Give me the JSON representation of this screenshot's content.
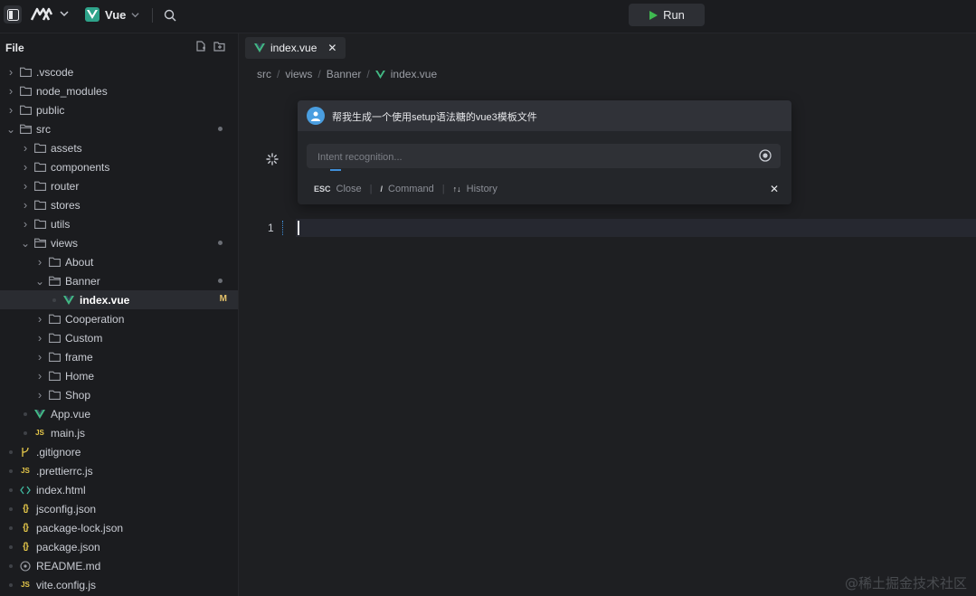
{
  "topbar": {
    "framework": "Vue",
    "run_label": "Run"
  },
  "sidebar": {
    "title": "File",
    "tree": [
      {
        "label": ".vscode",
        "type": "folder",
        "depth": 0,
        "open": false
      },
      {
        "label": "node_modules",
        "type": "folder",
        "depth": 0,
        "open": false
      },
      {
        "label": "public",
        "type": "folder",
        "depth": 0,
        "open": false
      },
      {
        "label": "src",
        "type": "folder",
        "depth": 0,
        "open": true,
        "badge": "dot"
      },
      {
        "label": "assets",
        "type": "folder",
        "depth": 1,
        "open": false
      },
      {
        "label": "components",
        "type": "folder",
        "depth": 1,
        "open": false
      },
      {
        "label": "router",
        "type": "folder",
        "depth": 1,
        "open": false
      },
      {
        "label": "stores",
        "type": "folder",
        "depth": 1,
        "open": false
      },
      {
        "label": "utils",
        "type": "folder",
        "depth": 1,
        "open": false
      },
      {
        "label": "views",
        "type": "folder",
        "depth": 1,
        "open": true,
        "badge": "dot"
      },
      {
        "label": "About",
        "type": "folder",
        "depth": 2,
        "open": false
      },
      {
        "label": "Banner",
        "type": "folder",
        "depth": 2,
        "open": true,
        "badge": "dot"
      },
      {
        "label": "index.vue",
        "type": "vue",
        "depth": 3,
        "selected": true,
        "badge": "M"
      },
      {
        "label": "Cooperation",
        "type": "folder",
        "depth": 2,
        "open": false
      },
      {
        "label": "Custom",
        "type": "folder",
        "depth": 2,
        "open": false
      },
      {
        "label": "frame",
        "type": "folder",
        "depth": 2,
        "open": false
      },
      {
        "label": "Home",
        "type": "folder",
        "depth": 2,
        "open": false
      },
      {
        "label": "Shop",
        "type": "folder",
        "depth": 2,
        "open": false
      },
      {
        "label": "App.vue",
        "type": "vue",
        "depth": 1
      },
      {
        "label": "main.js",
        "type": "js",
        "depth": 1
      },
      {
        "label": ".gitignore",
        "type": "git",
        "depth": 0
      },
      {
        "label": ".prettierrc.js",
        "type": "js",
        "depth": 0
      },
      {
        "label": "index.html",
        "type": "html",
        "depth": 0
      },
      {
        "label": "jsconfig.json",
        "type": "json",
        "depth": 0
      },
      {
        "label": "package-lock.json",
        "type": "json",
        "depth": 0
      },
      {
        "label": "package.json",
        "type": "json",
        "depth": 0
      },
      {
        "label": "README.md",
        "type": "md",
        "depth": 0
      },
      {
        "label": "vite.config.js",
        "type": "js",
        "depth": 0
      }
    ]
  },
  "editor": {
    "tab_label": "index.vue",
    "breadcrumb": [
      "src",
      "views",
      "Banner",
      "index.vue"
    ],
    "line_number": "1"
  },
  "ai": {
    "prompt": "帮我生成一个使用setup语法糖的vue3模板文件",
    "placeholder": "Intent recognition...",
    "hint_esc_key": "ESC",
    "hint_esc_label": "Close",
    "hint_cmd_key": "/",
    "hint_cmd_label": "Command",
    "hint_hist_key": "↑↓",
    "hint_hist_label": "History"
  },
  "watermark": "@稀土掘金技术社区",
  "colors": {
    "accent_vue": "#42b883",
    "run_green": "#3fb950",
    "modified": "#e4c26a",
    "json_brace": "#e6c84a"
  }
}
